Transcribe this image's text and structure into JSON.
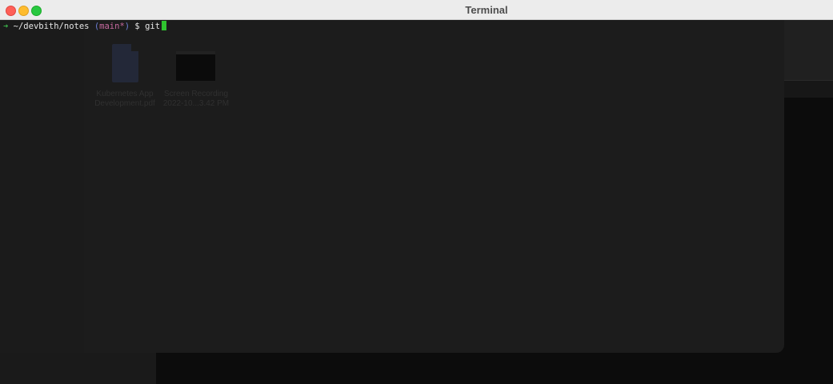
{
  "window": {
    "title": "Terminal"
  },
  "terminal": {
    "prompt_arrow": "➜",
    "cwd": "~/devbith/notes",
    "branch_open": "(",
    "branch_name": "main",
    "branch_dirty": "*",
    "branch_close": ")",
    "prompt_symbol": "$",
    "command": "git"
  },
  "background_files": [
    {
      "name_line1": "Kubernetes App",
      "name_line2": "Development.pdf"
    },
    {
      "name_line1": "Screen Recording",
      "name_line2": "2022-10...3.42 PM"
    }
  ]
}
